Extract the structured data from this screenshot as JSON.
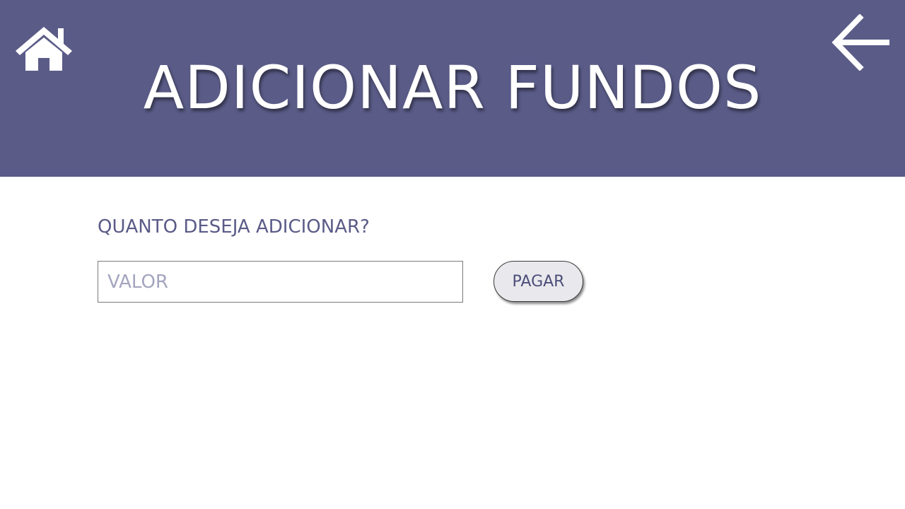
{
  "header": {
    "title": "ADICIONAR FUNDOS",
    "home_icon": "home-icon",
    "back_icon": "arrow-left-icon"
  },
  "form": {
    "question": "QUANTO DESEJA ADICIONAR?",
    "amount_placeholder": "VALOR",
    "amount_value": "",
    "pay_label": "PAGAR"
  },
  "colors": {
    "header_bg": "#5a5b87",
    "accent_text": "#5a5b87",
    "button_bg": "#e9e9ed",
    "placeholder": "#a4a5bf"
  }
}
